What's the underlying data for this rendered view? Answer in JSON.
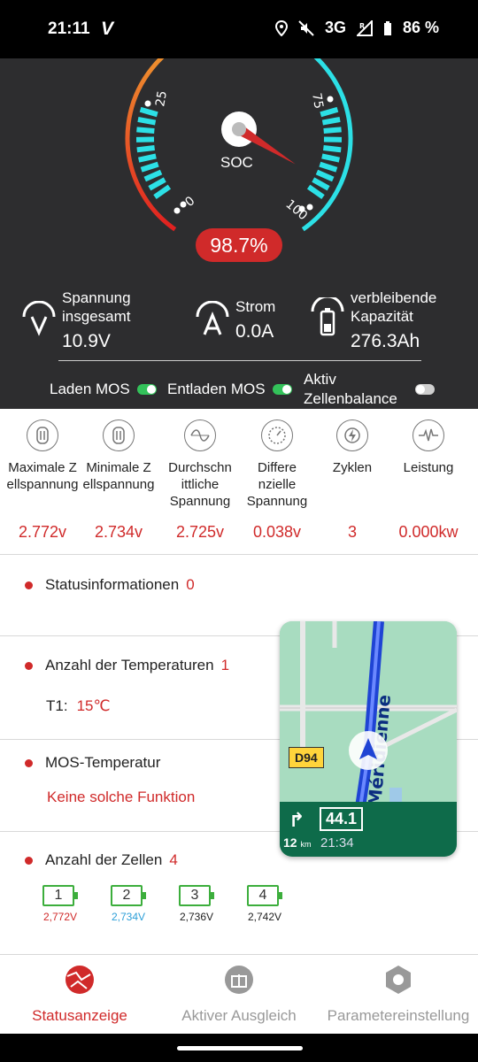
{
  "status_bar": {
    "time": "21:11",
    "logo": "V",
    "network": "3G",
    "network_sup": "R",
    "battery": "86 %"
  },
  "gauge": {
    "soc_label": "SOC",
    "soc_value": "98.7%",
    "soc_fraction": 0.987,
    "ticks": [
      "0",
      "25",
      "75",
      "100"
    ]
  },
  "metrics": {
    "voltage": {
      "label": "Spannung insgesamt",
      "value": "10.9V",
      "icon": "voltage-icon"
    },
    "current": {
      "label": "Strom",
      "value": "0.0A",
      "icon": "current-icon"
    },
    "capacity": {
      "label": "verbleibende Kapazität",
      "value": "276.3Ah",
      "icon": "battery-icon"
    }
  },
  "toggles": {
    "charge_label": "Laden MOS",
    "charge_on": true,
    "discharge_label": "Entladen MOS",
    "discharge_on": true,
    "balance_label": "Aktiv Zellenbalance",
    "balance_on": false
  },
  "stats": [
    {
      "label": "Maximale Z ellspannung",
      "value": "2.772v",
      "icon": "max-voltage-icon"
    },
    {
      "label": "Minimale Z ellspannung",
      "value": "2.734v",
      "icon": "min-voltage-icon"
    },
    {
      "label": "Durchschn ittliche Spannung",
      "value": "2.725v",
      "icon": "average-wave-icon"
    },
    {
      "label": "Differe nzielle Spannung",
      "value": "0.038v",
      "icon": "gauge-dial-icon"
    },
    {
      "label": "Zyklen",
      "value": "3",
      "icon": "cycle-bolt-icon"
    },
    {
      "label": "Leistung",
      "value": "0.000kw",
      "icon": "power-pulse-icon"
    }
  ],
  "sections": {
    "status": {
      "title": "Statusinformationen",
      "count": "0"
    },
    "temperatures": {
      "title": "Anzahl der Temperaturen",
      "count": "1",
      "t1_label": "T1:",
      "t1_value": "15℃"
    },
    "mos_temp": {
      "title": "MOS-Temperatur",
      "value": "Keine solche Funktion"
    },
    "cells": {
      "title": "Anzahl der Zellen",
      "count": "4",
      "items": [
        {
          "index": "1",
          "voltage": "2,772V",
          "color": "#d02a2a"
        },
        {
          "index": "2",
          "voltage": "2,734V",
          "color": "#2d9fd8"
        },
        {
          "index": "3",
          "voltage": "2,736V",
          "color": "#222222"
        },
        {
          "index": "4",
          "voltage": "2,742V",
          "color": "#222222"
        }
      ]
    }
  },
  "nav_overlay": {
    "road_label": "D94",
    "street": "Méridienne",
    "speed": "44.1",
    "distance": "12",
    "distance_unit": "km",
    "eta": "21:34"
  },
  "bottom_nav": [
    {
      "label": "Statusanzeige",
      "active": true
    },
    {
      "label": "Aktiver Ausgleich",
      "active": false
    },
    {
      "label": "Parametereinstellung",
      "active": false
    }
  ],
  "colors": {
    "accent": "#d02a2a",
    "green": "#33c25a",
    "cyan": "#2ce0e6",
    "dark_bg": "#2d2d2f"
  }
}
